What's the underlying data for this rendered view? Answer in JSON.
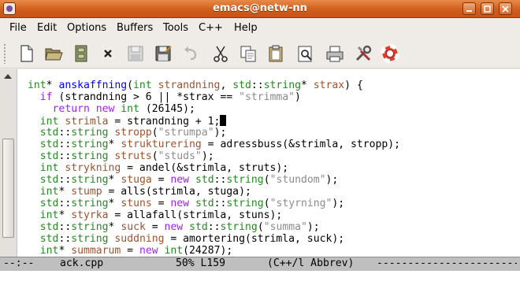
{
  "window": {
    "title": "emacs@netw-nn"
  },
  "menu": [
    "File",
    "Edit",
    "Options",
    "Buffers",
    "Tools",
    "C++",
    "Help"
  ],
  "toolbar": [
    "new-file",
    "open-folder",
    "cabinet",
    "close",
    "save",
    "save-as",
    "undo",
    "cut",
    "copy",
    "paste",
    "search",
    "print",
    "preferences",
    "help"
  ],
  "editor": {
    "lines": [
      [
        {
          "t": "int",
          "c": "ty"
        },
        {
          "t": "* ",
          "c": ""
        },
        {
          "t": "anskaffning",
          "c": "fn"
        },
        {
          "t": "(",
          "c": ""
        },
        {
          "t": "int",
          "c": "ty"
        },
        {
          "t": " ",
          "c": ""
        },
        {
          "t": "strandning",
          "c": "vr"
        },
        {
          "t": ", ",
          "c": ""
        },
        {
          "t": "std",
          "c": "ty"
        },
        {
          "t": "::",
          "c": ""
        },
        {
          "t": "string",
          "c": "ty"
        },
        {
          "t": "* ",
          "c": ""
        },
        {
          "t": "strax",
          "c": "vr"
        },
        {
          "t": ") {",
          "c": ""
        }
      ],
      [
        {
          "t": "  ",
          "c": ""
        },
        {
          "t": "if",
          "c": "kw"
        },
        {
          "t": " (strandning > 6 || *strax == ",
          "c": ""
        },
        {
          "t": "\"strimma\"",
          "c": "st"
        },
        {
          "t": ")",
          "c": ""
        }
      ],
      [
        {
          "t": "    ",
          "c": ""
        },
        {
          "t": "return",
          "c": "kw"
        },
        {
          "t": " ",
          "c": ""
        },
        {
          "t": "new",
          "c": "kw"
        },
        {
          "t": " ",
          "c": ""
        },
        {
          "t": "int",
          "c": "ty"
        },
        {
          "t": " (26145);",
          "c": ""
        }
      ],
      [
        {
          "t": "  ",
          "c": ""
        },
        {
          "t": "int",
          "c": "ty"
        },
        {
          "t": " ",
          "c": ""
        },
        {
          "t": "strimla",
          "c": "vr"
        },
        {
          "t": " = strandning + 1;",
          "c": ""
        }
      ],
      [
        {
          "t": "  ",
          "c": ""
        },
        {
          "t": "std",
          "c": "ty"
        },
        {
          "t": "::",
          "c": ""
        },
        {
          "t": "string",
          "c": "ty"
        },
        {
          "t": " ",
          "c": ""
        },
        {
          "t": "stropp",
          "c": "vr"
        },
        {
          "t": "(",
          "c": ""
        },
        {
          "t": "\"strumpa\"",
          "c": "st"
        },
        {
          "t": ");",
          "c": ""
        }
      ],
      [
        {
          "t": "  ",
          "c": ""
        },
        {
          "t": "std",
          "c": "ty"
        },
        {
          "t": "::",
          "c": ""
        },
        {
          "t": "string",
          "c": "ty"
        },
        {
          "t": "* ",
          "c": ""
        },
        {
          "t": "strukturering",
          "c": "vr"
        },
        {
          "t": " = adressbuss(&strimla, stropp);",
          "c": ""
        }
      ],
      [
        {
          "t": "  ",
          "c": ""
        },
        {
          "t": "std",
          "c": "ty"
        },
        {
          "t": "::",
          "c": ""
        },
        {
          "t": "string",
          "c": "ty"
        },
        {
          "t": " ",
          "c": ""
        },
        {
          "t": "struts",
          "c": "vr"
        },
        {
          "t": "(",
          "c": ""
        },
        {
          "t": "\"studs\"",
          "c": "st"
        },
        {
          "t": ");",
          "c": ""
        }
      ],
      [
        {
          "t": "  ",
          "c": ""
        },
        {
          "t": "int",
          "c": "ty"
        },
        {
          "t": " ",
          "c": ""
        },
        {
          "t": "strykning",
          "c": "vr"
        },
        {
          "t": " = andel(&strimla, struts);",
          "c": ""
        }
      ],
      [
        {
          "t": "  ",
          "c": ""
        },
        {
          "t": "std",
          "c": "ty"
        },
        {
          "t": "::",
          "c": ""
        },
        {
          "t": "string",
          "c": "ty"
        },
        {
          "t": "* ",
          "c": ""
        },
        {
          "t": "stuga",
          "c": "vr"
        },
        {
          "t": " = ",
          "c": ""
        },
        {
          "t": "new",
          "c": "kw"
        },
        {
          "t": " ",
          "c": ""
        },
        {
          "t": "std",
          "c": "ty"
        },
        {
          "t": "::",
          "c": ""
        },
        {
          "t": "string",
          "c": "ty"
        },
        {
          "t": "(",
          "c": ""
        },
        {
          "t": "\"stundom\"",
          "c": "st"
        },
        {
          "t": ");",
          "c": ""
        }
      ],
      [
        {
          "t": "  ",
          "c": ""
        },
        {
          "t": "int",
          "c": "ty"
        },
        {
          "t": "* ",
          "c": ""
        },
        {
          "t": "stump",
          "c": "vr"
        },
        {
          "t": " = alls(strimla, stuga);",
          "c": ""
        }
      ],
      [
        {
          "t": "  ",
          "c": ""
        },
        {
          "t": "std",
          "c": "ty"
        },
        {
          "t": "::",
          "c": ""
        },
        {
          "t": "string",
          "c": "ty"
        },
        {
          "t": "* ",
          "c": ""
        },
        {
          "t": "stuns",
          "c": "vr"
        },
        {
          "t": " = ",
          "c": ""
        },
        {
          "t": "new",
          "c": "kw"
        },
        {
          "t": " ",
          "c": ""
        },
        {
          "t": "std",
          "c": "ty"
        },
        {
          "t": "::",
          "c": ""
        },
        {
          "t": "string",
          "c": "ty"
        },
        {
          "t": "(",
          "c": ""
        },
        {
          "t": "\"styrning\"",
          "c": "st"
        },
        {
          "t": ");",
          "c": ""
        }
      ],
      [
        {
          "t": "  ",
          "c": ""
        },
        {
          "t": "int",
          "c": "ty"
        },
        {
          "t": "* ",
          "c": ""
        },
        {
          "t": "styrka",
          "c": "vr"
        },
        {
          "t": " = allafall(strimla, stuns);",
          "c": ""
        }
      ],
      [
        {
          "t": "  ",
          "c": ""
        },
        {
          "t": "std",
          "c": "ty"
        },
        {
          "t": "::",
          "c": ""
        },
        {
          "t": "string",
          "c": "ty"
        },
        {
          "t": "* ",
          "c": ""
        },
        {
          "t": "suck",
          "c": "vr"
        },
        {
          "t": " = ",
          "c": ""
        },
        {
          "t": "new",
          "c": "kw"
        },
        {
          "t": " ",
          "c": ""
        },
        {
          "t": "std",
          "c": "ty"
        },
        {
          "t": "::",
          "c": ""
        },
        {
          "t": "string",
          "c": "ty"
        },
        {
          "t": "(",
          "c": ""
        },
        {
          "t": "\"summa\"",
          "c": "st"
        },
        {
          "t": ");",
          "c": ""
        }
      ],
      [
        {
          "t": "  ",
          "c": ""
        },
        {
          "t": "std",
          "c": "ty"
        },
        {
          "t": "::",
          "c": ""
        },
        {
          "t": "string",
          "c": "ty"
        },
        {
          "t": " ",
          "c": ""
        },
        {
          "t": "suddning",
          "c": "vr"
        },
        {
          "t": " = amortering(strimla, suck);",
          "c": ""
        }
      ],
      [
        {
          "t": "  ",
          "c": ""
        },
        {
          "t": "int",
          "c": "ty"
        },
        {
          "t": "* ",
          "c": ""
        },
        {
          "t": "summarum",
          "c": "vr"
        },
        {
          "t": " = ",
          "c": ""
        },
        {
          "t": "new",
          "c": "kw"
        },
        {
          "t": " ",
          "c": ""
        },
        {
          "t": "int",
          "c": "ty"
        },
        {
          "t": "(24287);",
          "c": ""
        }
      ]
    ],
    "cursor_line": 3
  },
  "modeline": {
    "flags": "--:--",
    "buffer": "ack.cpp",
    "position": "50% L159",
    "mode": "(C++/l Abbrev)",
    "fill": "------------------------------------------"
  },
  "colors": {
    "keyword": "#a020f0",
    "type": "#228b22",
    "function": "#0000ff",
    "variable": "#a0522d",
    "string": "#8b8b8b",
    "titlebar": "#d15e1b"
  }
}
